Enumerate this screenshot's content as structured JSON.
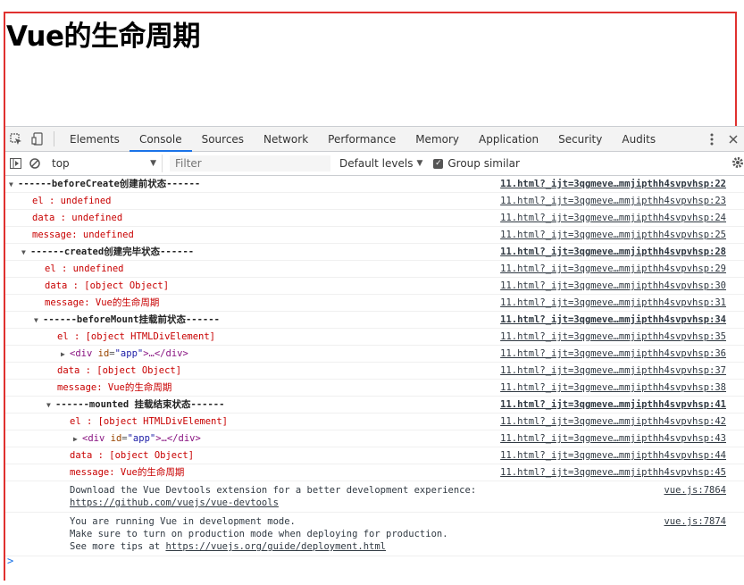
{
  "page": {
    "heading": "Vue的生命周期",
    "frame_color": "#e0312f"
  },
  "devtools": {
    "tabs": [
      "Elements",
      "Console",
      "Sources",
      "Network",
      "Performance",
      "Memory",
      "Application",
      "Security",
      "Audits"
    ],
    "active_tab": "Console",
    "filterbar": {
      "context": "top",
      "filter_placeholder": "Filter",
      "levels": "Default levels",
      "group_similar": "Group similar",
      "group_similar_checked": true
    },
    "rows": [
      {
        "kind": "group",
        "indent": 0,
        "text": "------beforeCreate创建前状态------",
        "src": "11.html?_ijt=3qgmeve…mmjipthh4svpvhsp:22"
      },
      {
        "kind": "log",
        "indent": 1,
        "text": "el     : undefined",
        "src": "11.html?_ijt=3qgmeve…mmjipthh4svpvhsp:23"
      },
      {
        "kind": "log",
        "indent": 1,
        "text": "data   : undefined",
        "src": "11.html?_ijt=3qgmeve…mmjipthh4svpvhsp:24"
      },
      {
        "kind": "log",
        "indent": 1,
        "text": "message: undefined",
        "src": "11.html?_ijt=3qgmeve…mmjipthh4svpvhsp:25"
      },
      {
        "kind": "group",
        "indent": 1,
        "text": "------created创建完毕状态------",
        "src": "11.html?_ijt=3qgmeve…mmjipthh4svpvhsp:28"
      },
      {
        "kind": "log",
        "indent": 2,
        "text": "el     : undefined",
        "src": "11.html?_ijt=3qgmeve…mmjipthh4svpvhsp:29"
      },
      {
        "kind": "log",
        "indent": 2,
        "text": "data   : [object Object]",
        "src": "11.html?_ijt=3qgmeve…mmjipthh4svpvhsp:30"
      },
      {
        "kind": "log",
        "indent": 2,
        "text": "message: Vue的生命周期",
        "src": "11.html?_ijt=3qgmeve…mmjipthh4svpvhsp:31"
      },
      {
        "kind": "group",
        "indent": 2,
        "text": "------beforeMount挂载前状态------",
        "src": "11.html?_ijt=3qgmeve…mmjipthh4svpvhsp:34"
      },
      {
        "kind": "log",
        "indent": 3,
        "text": "el     : [object HTMLDivElement]",
        "src": "11.html?_ijt=3qgmeve…mmjipthh4svpvhsp:35"
      },
      {
        "kind": "element",
        "indent": 3,
        "tag_open": "<div",
        "attr_name": "id",
        "attr_value": "\"app\"",
        "tag_rest": ">…</div>",
        "src": "11.html?_ijt=3qgmeve…mmjipthh4svpvhsp:36"
      },
      {
        "kind": "log",
        "indent": 3,
        "text": "data   : [object Object]",
        "src": "11.html?_ijt=3qgmeve…mmjipthh4svpvhsp:37"
      },
      {
        "kind": "log",
        "indent": 3,
        "text": "message: Vue的生命周期",
        "src": "11.html?_ijt=3qgmeve…mmjipthh4svpvhsp:38"
      },
      {
        "kind": "group",
        "indent": 3,
        "text": "------mounted 挂载结束状态------",
        "src": "11.html?_ijt=3qgmeve…mmjipthh4svpvhsp:41"
      },
      {
        "kind": "log",
        "indent": 4,
        "text": "el     : [object HTMLDivElement]",
        "src": "11.html?_ijt=3qgmeve…mmjipthh4svpvhsp:42"
      },
      {
        "kind": "element",
        "indent": 4,
        "tag_open": "<div",
        "attr_name": "id",
        "attr_value": "\"app\"",
        "tag_rest": ">…</div>",
        "src": "11.html?_ijt=3qgmeve…mmjipthh4svpvhsp:43"
      },
      {
        "kind": "log",
        "indent": 4,
        "text": "data   : [object Object]",
        "src": "11.html?_ijt=3qgmeve…mmjipthh4svpvhsp:44"
      },
      {
        "kind": "log",
        "indent": 4,
        "text": "message: Vue的生命周期",
        "src": "11.html?_ijt=3qgmeve…mmjipthh4svpvhsp:45"
      }
    ],
    "info_messages": [
      {
        "lines": [
          "Download the Vue Devtools extension for a better development experience:"
        ],
        "link": "https://github.com/vuejs/vue-devtools",
        "src": "vue.js:7864"
      },
      {
        "lines": [
          "You are running Vue in development mode.",
          "Make sure to turn on production mode when deploying for production."
        ],
        "link_prefix": "See more tips at ",
        "link": "https://vuejs.org/guide/deployment.html",
        "src": "vue.js:7874"
      }
    ],
    "prompt_symbol": ">"
  }
}
